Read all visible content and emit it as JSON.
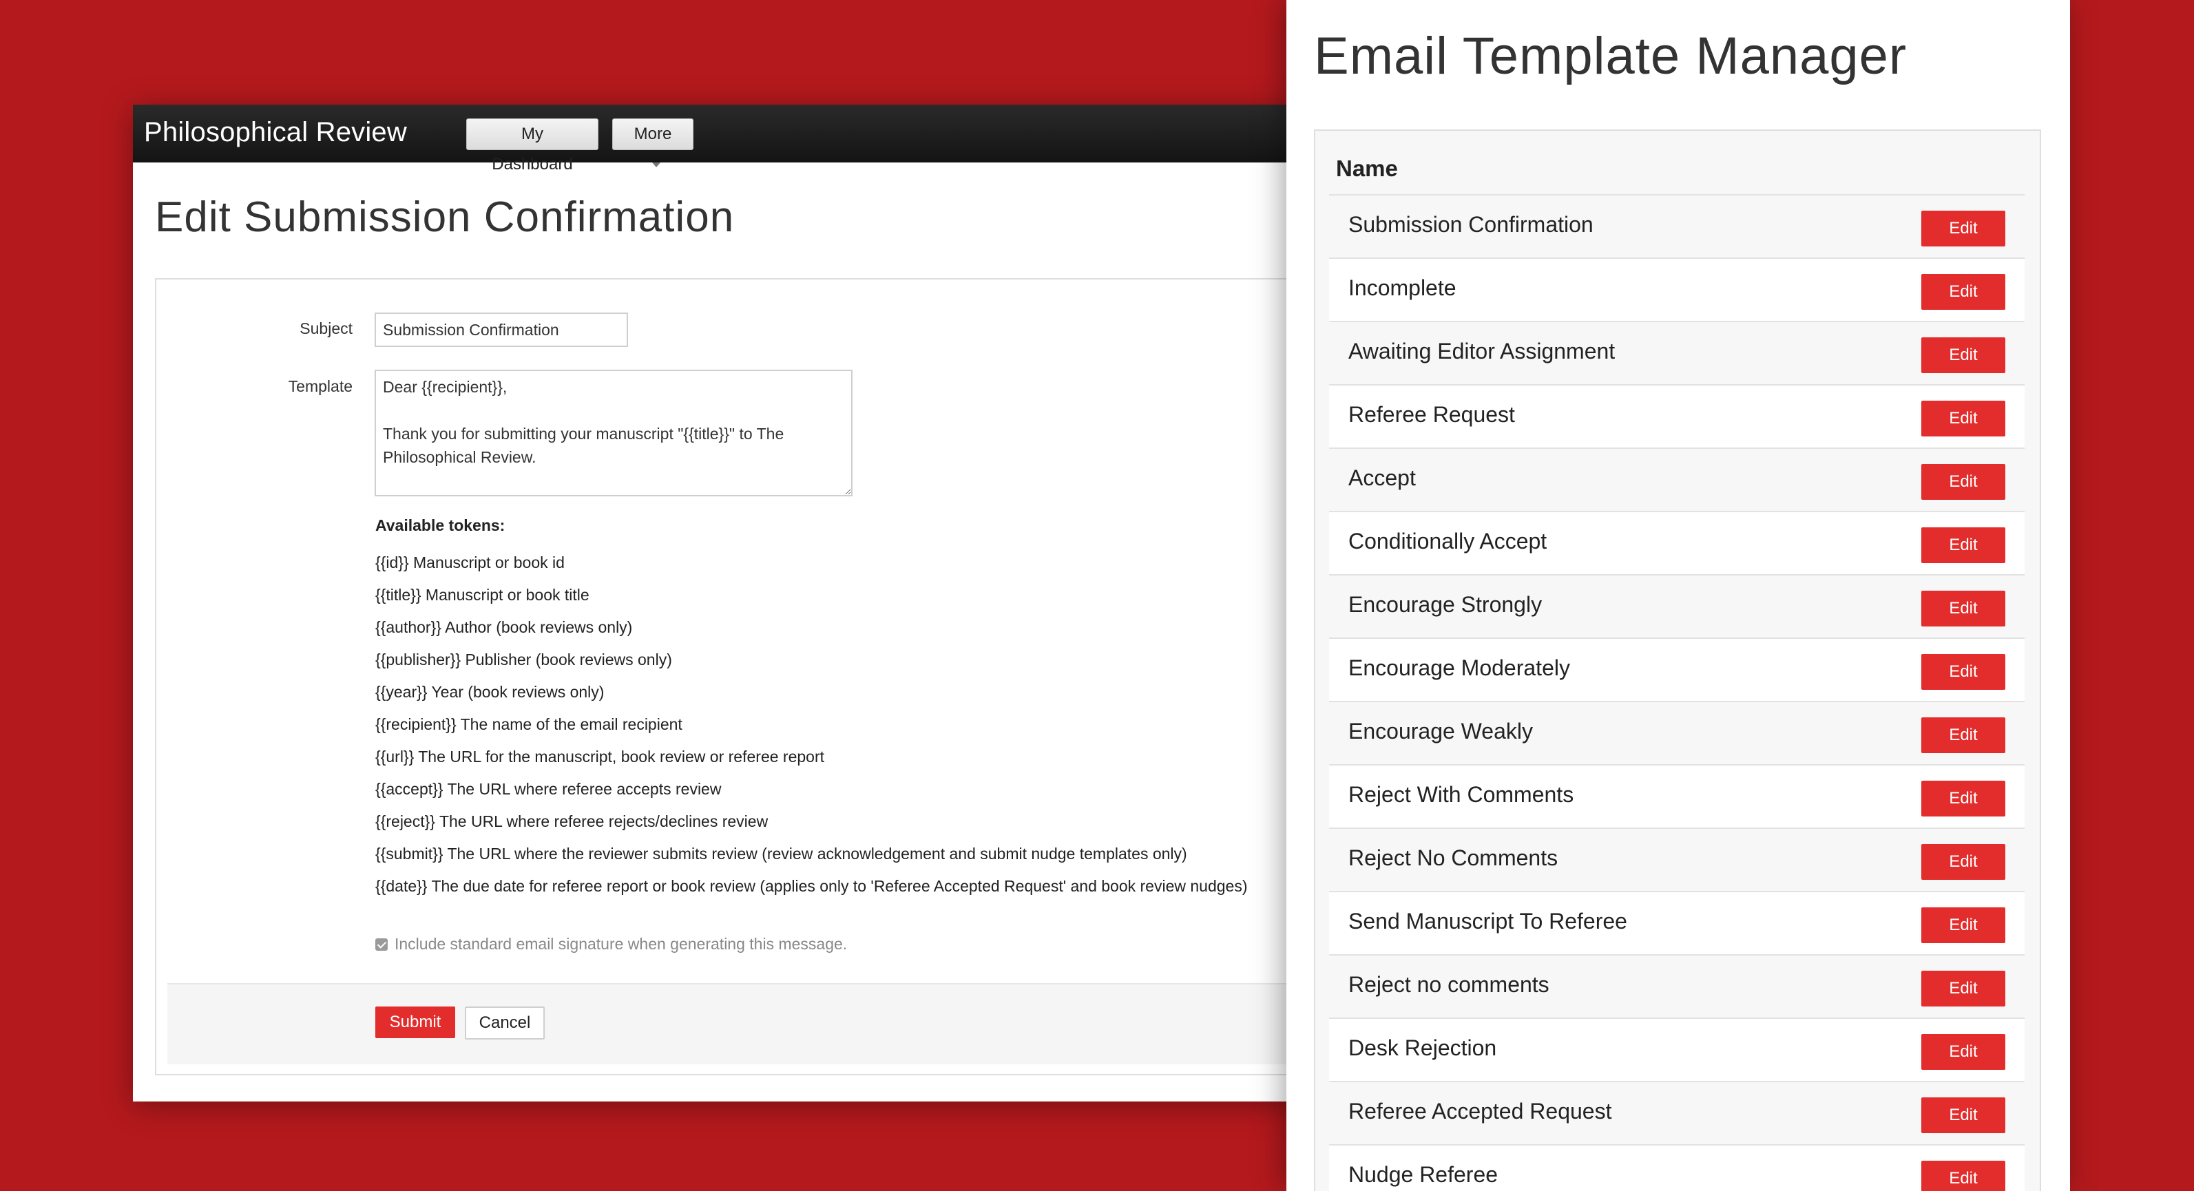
{
  "colors": {
    "background": "#b4191d",
    "accent": "#e32d2d",
    "navbar": "#1c1c1c"
  },
  "edit_page": {
    "brand": "Philosophical Review",
    "nav": {
      "dashboard_label": "My Dashboard",
      "more_label": "More"
    },
    "title": "Edit Submission Confirmation",
    "form": {
      "subject_label": "Subject",
      "subject_value": "Submission Confirmation",
      "template_label": "Template",
      "template_value": "Dear {{recipient}},\n\nThank you for submitting your manuscript \"{{title}}\" to The Philosophical Review.",
      "tokens_heading": "Available tokens:",
      "tokens": [
        "{{id}} Manuscript or book id",
        "{{title}} Manuscript or book title",
        "{{author}} Author (book reviews only)",
        "{{publisher}} Publisher (book reviews only)",
        "{{year}} Year (book reviews only)",
        "{{recipient}} The name of the email recipient",
        "{{url}} The URL for the manuscript, book review or referee report",
        "{{accept}} The URL where referee accepts review",
        "{{reject}} The URL where referee rejects/declines review",
        "{{submit}} The URL where the reviewer submits review (review acknowledgement and submit nudge templates only)",
        "{{date}} The due date for referee report or book review (applies only to 'Referee Accepted Request' and book review nudges)"
      ],
      "signature_label": "Include standard email signature when generating this message.",
      "signature_checked": true,
      "submit_label": "Submit",
      "cancel_label": "Cancel"
    }
  },
  "manager": {
    "title": "Email Template Manager",
    "column_header": "Name",
    "edit_label": "Edit",
    "templates": [
      "Submission Confirmation",
      "Incomplete",
      "Awaiting Editor Assignment",
      "Referee Request",
      "Accept",
      "Conditionally Accept",
      "Encourage Strongly",
      "Encourage Moderately",
      "Encourage Weakly",
      "Reject With Comments",
      "Reject No Comments",
      "Send Manuscript To Referee",
      "Reject no comments",
      "Desk Rejection",
      "Referee Accepted Request",
      "Nudge Referee"
    ]
  }
}
